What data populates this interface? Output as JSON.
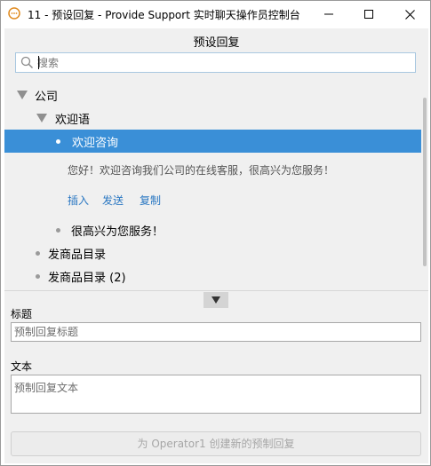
{
  "window": {
    "title": "11 - 预设回复 - Provide Support 实时聊天操作员控制台"
  },
  "panel": {
    "title": "预设回复"
  },
  "search": {
    "placeholder": "搜索"
  },
  "tree": {
    "root_label": "公司",
    "group_label": "欢迎语",
    "selected_item_label": "欢迎咨询",
    "selected_preview": "您好！欢迎咨询我们公司的在线客服，很高兴为您服务！",
    "actions": {
      "insert": "插入",
      "send": "发送",
      "copy": "复制"
    },
    "next_item_label": "很高兴为您服务！",
    "catalog_item_label": "发商品目录",
    "catalog2_item_label": "发商品目录 (2)"
  },
  "form": {
    "title_label": "标题",
    "title_placeholder": "预制回复标题",
    "text_label": "文本",
    "text_placeholder": "预制回复文本",
    "create_button": "为 Operator1 创建新的预制回复"
  },
  "colors": {
    "selection": "#3a8fd7",
    "link": "#2a77c2"
  },
  "icons": {
    "app": "chat-bubble-icon",
    "search": "search-icon",
    "collapse": "triangle-down-icon"
  }
}
